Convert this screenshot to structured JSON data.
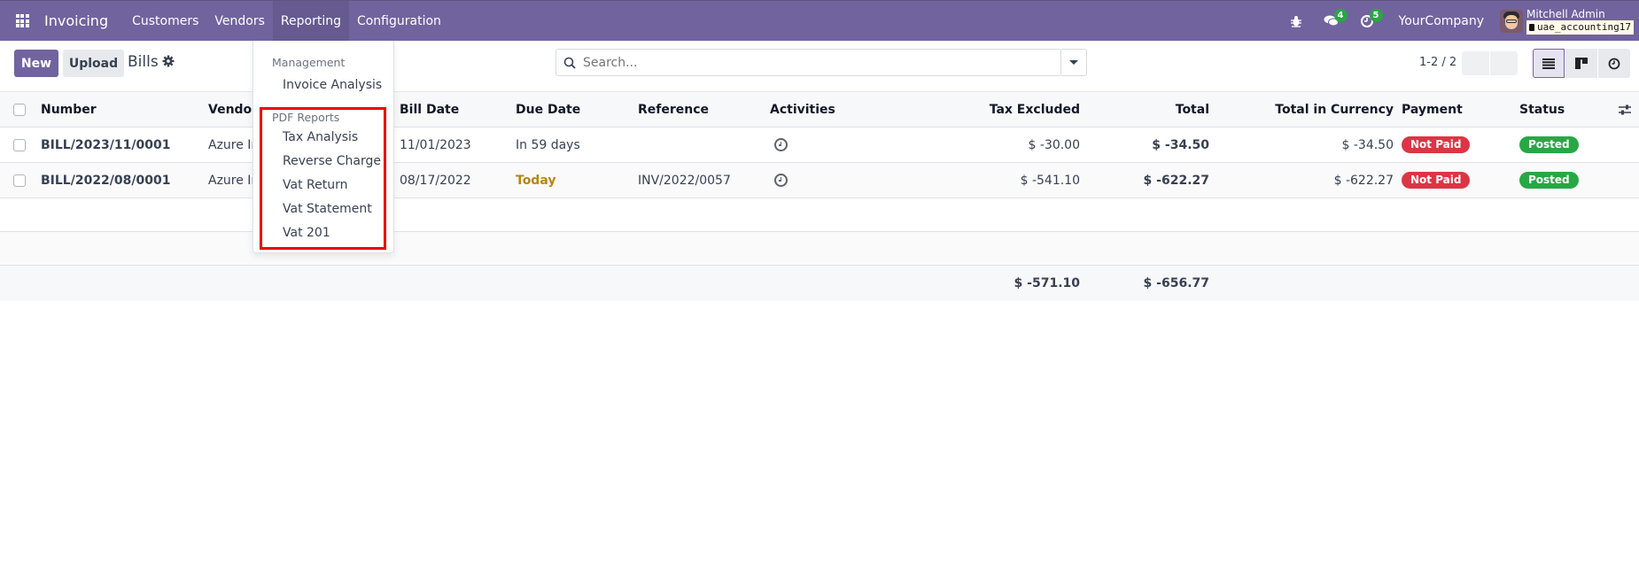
{
  "navbar": {
    "app_name": "Invoicing",
    "menu": [
      "Customers",
      "Vendors",
      "Reporting",
      "Configuration"
    ],
    "active_menu": "Reporting",
    "messages_count": "4",
    "activities_count": "5",
    "company": "YourCompany",
    "user_name": "Mitchell Admin",
    "database": "uae_accounting17"
  },
  "control_panel": {
    "new_label": "New",
    "upload_label": "Upload",
    "title": "Bills",
    "search_placeholder": "Search...",
    "pager": "1-2 / 2"
  },
  "reporting_menu": {
    "sections": [
      {
        "header": "Management",
        "items": [
          "Invoice Analysis"
        ]
      },
      {
        "header": "PDF Reports",
        "items": [
          "Tax Analysis",
          "Reverse Charge",
          "Vat Return",
          "Vat Statement",
          "Vat 201"
        ]
      }
    ]
  },
  "table": {
    "columns": [
      "Number",
      "Vendor",
      "Bill Date",
      "Due Date",
      "Reference",
      "Activities",
      "Tax Excluded",
      "Total",
      "Total in Currency",
      "Payment",
      "Status"
    ],
    "rows": [
      {
        "number": "BILL/2023/11/0001",
        "vendor": "Azure Ir",
        "bill_date": "11/01/2023",
        "due_date": "In 59 days",
        "reference": "",
        "tax_excluded": "$ -30.00",
        "total": "$ -34.50",
        "total_currency": "$ -34.50",
        "payment": "Not Paid",
        "status": "Posted"
      },
      {
        "number": "BILL/2022/08/0001",
        "vendor": "Azure Ir",
        "bill_date": "08/17/2022",
        "due_date": "Today",
        "reference": "INV/2022/0057",
        "tax_excluded": "$ -541.10",
        "total": "$ -622.27",
        "total_currency": "$ -622.27",
        "payment": "Not Paid",
        "status": "Posted"
      }
    ],
    "footer": {
      "tax_excluded": "$ -571.10",
      "total": "$ -656.77"
    }
  },
  "colors": {
    "brand": "#71639e",
    "not_paid": "#dc3545",
    "posted": "#28a745",
    "today": "#b8860b",
    "highlight": "#ee0000"
  }
}
